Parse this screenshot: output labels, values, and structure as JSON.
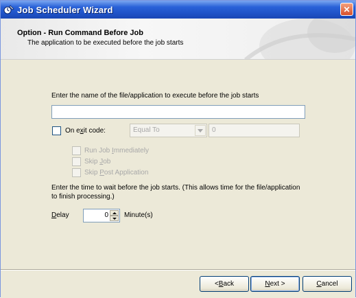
{
  "window": {
    "title": "Job Scheduler Wizard",
    "close_symbol": "✕"
  },
  "header": {
    "title": "Option - Run Command Before Job",
    "subtitle": "The application to be executed before the job starts"
  },
  "form": {
    "file_prompt": "Enter the name of the file/application to execute before the job starts",
    "file_value": "",
    "exit_code_checkbox": {
      "label_pre": "On e",
      "label_accel": "x",
      "label_post": "it code:",
      "checked": false
    },
    "comparison_select": {
      "value": "Equal To"
    },
    "exit_code_value": "0",
    "options": [
      {
        "label_pre": "Run Job ",
        "label_accel": "I",
        "label_post": "mmediately",
        "checked": false,
        "enabled": false
      },
      {
        "label_pre": "Skip ",
        "label_accel": "J",
        "label_post": "ob",
        "checked": false,
        "enabled": false
      },
      {
        "label_pre": "Skip ",
        "label_accel": "P",
        "label_post": "ost Application",
        "checked": false,
        "enabled": false
      }
    ],
    "wait_prompt_line1": "Enter the time to wait before the job starts. (This allows time for the file/application",
    "wait_prompt_line2": "to finish processing.)",
    "delay_label_accel": "D",
    "delay_label_rest": "elay",
    "delay_value": "0",
    "delay_unit": "Minute(s)"
  },
  "buttons": {
    "back": {
      "lt": "< ",
      "accel": "B",
      "rest": "ack"
    },
    "next": {
      "accel": "N",
      "rest": "ext >"
    },
    "cancel": {
      "accel": "C",
      "rest": "ancel"
    }
  },
  "icons": {
    "title": "scheduler-app-icon",
    "close": "close-icon",
    "combo": "chevron-down-icon",
    "spin_up": "spin-up-icon",
    "spin_down": "spin-down-icon"
  },
  "colors": {
    "titlebar": "#1f53c8",
    "dialog_bg": "#ece9d8",
    "close_button": "#d8502c"
  }
}
